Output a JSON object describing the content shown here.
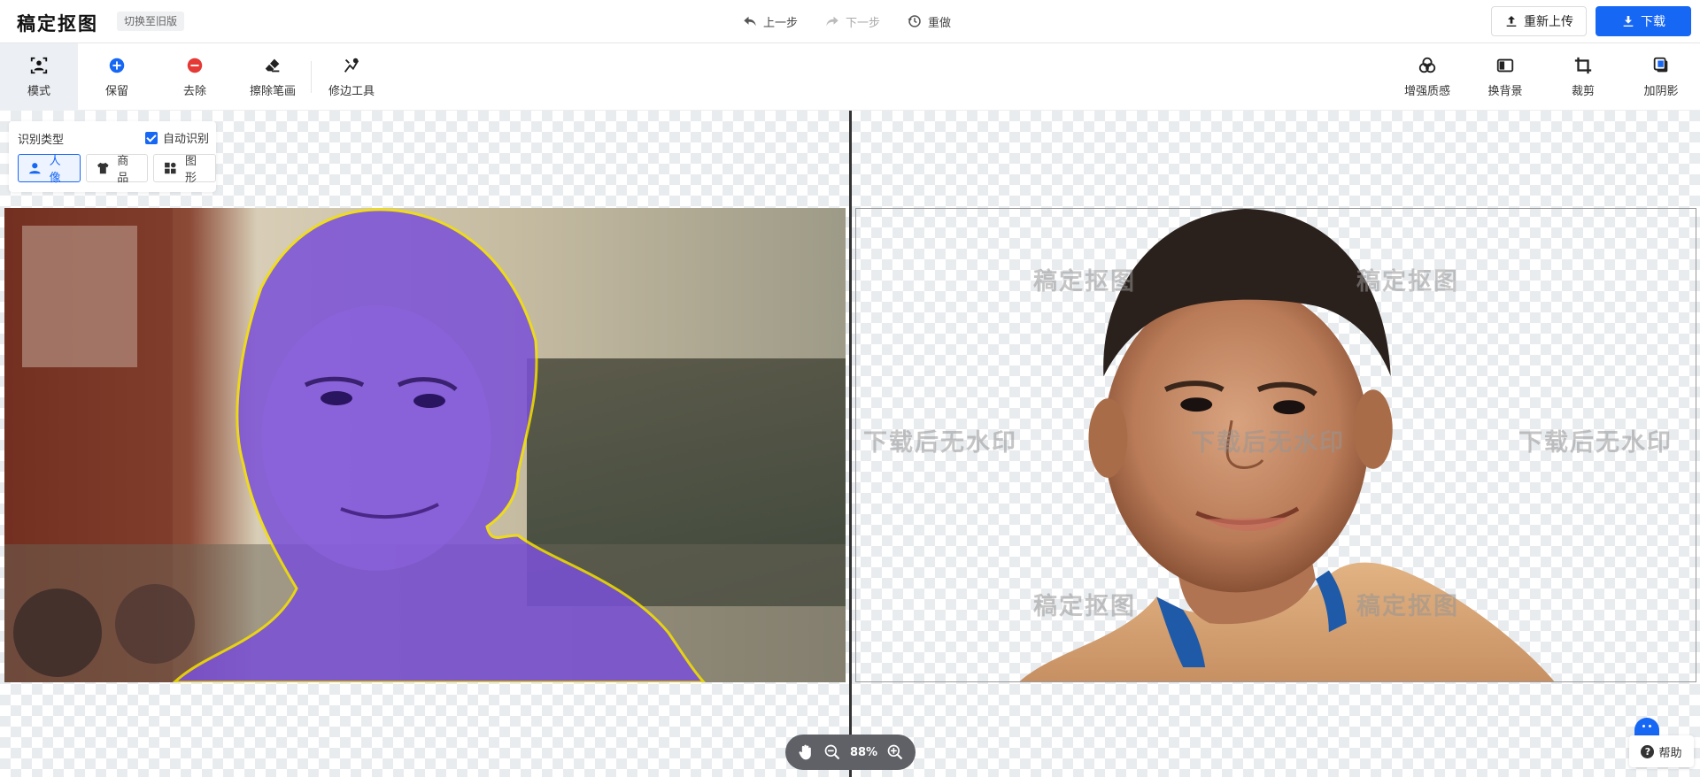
{
  "header": {
    "logo": "稿定抠图",
    "old_version": "切换至旧版",
    "undo": "上一步",
    "redo": "下一步",
    "redo_all": "重做",
    "reupload": "重新上传",
    "download": "下载"
  },
  "toolbar": {
    "left": [
      {
        "label": "模式",
        "icon": "mode-icon",
        "active": true
      },
      {
        "label": "保留",
        "icon": "plus-circle-icon"
      },
      {
        "label": "去除",
        "icon": "minus-circle-icon"
      },
      {
        "label": "擦除笔画",
        "icon": "eraser-icon"
      },
      {
        "label": "修边工具",
        "icon": "edge-tool-icon"
      }
    ],
    "right": [
      {
        "label": "增强质感",
        "icon": "enhance-icon"
      },
      {
        "label": "换背景",
        "icon": "background-icon"
      },
      {
        "label": "裁剪",
        "icon": "crop-icon"
      },
      {
        "label": "加阴影",
        "icon": "shadow-icon"
      }
    ]
  },
  "type_panel": {
    "title": "识别类型",
    "auto_label": "自动识别",
    "auto_checked": true,
    "types": [
      {
        "label": "人像",
        "icon": "person-icon",
        "active": true
      },
      {
        "label": "商品",
        "icon": "shirt-icon"
      },
      {
        "label": "图形",
        "icon": "shapes-icon"
      }
    ]
  },
  "watermarks": {
    "brand": "稿定抠图",
    "notice": "下载后无水印"
  },
  "zoom": {
    "value": "88%"
  },
  "help": {
    "label": "帮助"
  },
  "colors": {
    "accent": "#1767f5",
    "selection_outline": "#f5e100",
    "selection_tint": "#7a50d8"
  }
}
